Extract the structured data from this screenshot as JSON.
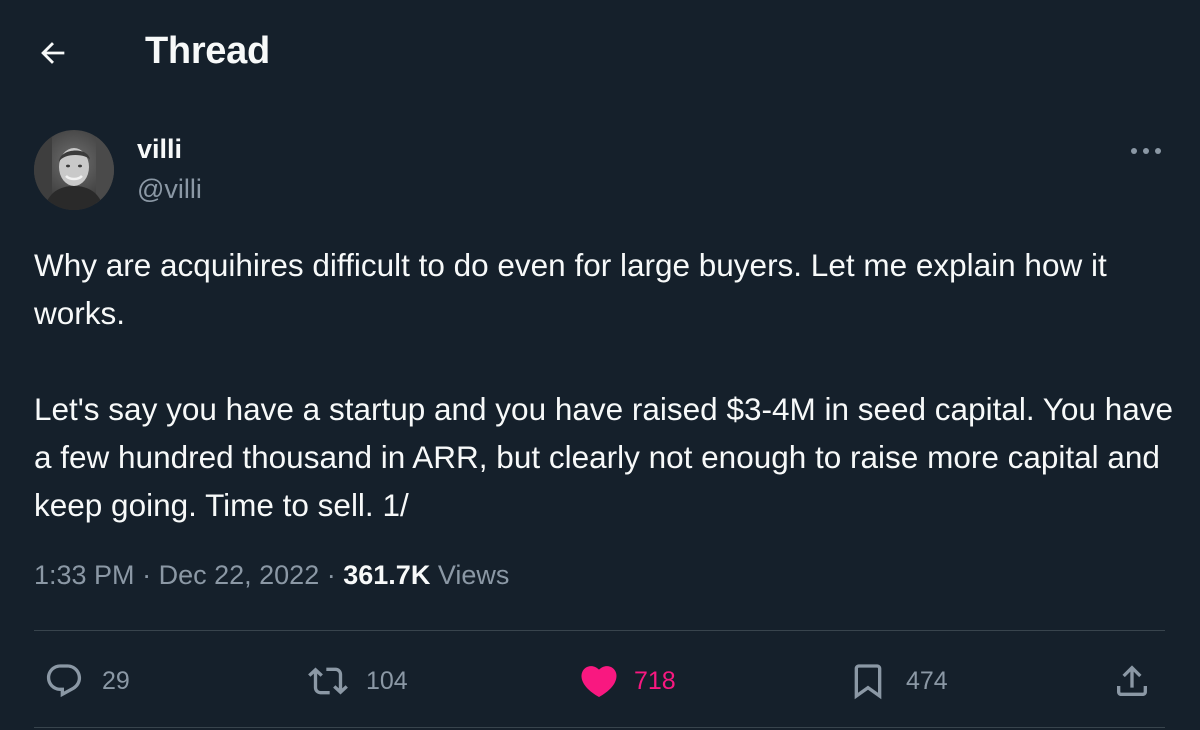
{
  "header": {
    "title": "Thread",
    "back_icon": "arrow-left-icon"
  },
  "author": {
    "name": "villi",
    "handle": "@villi",
    "avatar_icon": "profile-photo",
    "more_icon": "more-dots-icon"
  },
  "tweet": {
    "paragraphs": [
      "Why are acquihires difficult to do even for large buyers. Let me explain how it works.",
      "Let's say you have a startup and you have raised $3-4M in seed capital. You have a few hundred thousand in ARR, but clearly not enough to raise more capital and keep going. Time to sell. 1/"
    ]
  },
  "meta": {
    "time": "1:33 PM",
    "separator": "·",
    "date": "Dec 22, 2022",
    "views_count": "361.7K",
    "views_label": "Views"
  },
  "actions": {
    "reply": {
      "icon": "reply-icon",
      "count": "29"
    },
    "retweet": {
      "icon": "retweet-icon",
      "count": "104"
    },
    "like": {
      "icon": "heart-filled-icon",
      "count": "718",
      "liked": true
    },
    "bookmark": {
      "icon": "bookmark-icon",
      "count": "474"
    },
    "share": {
      "icon": "share-icon"
    }
  },
  "colors": {
    "background": "#15202b",
    "text_primary": "#f7f9f9",
    "text_secondary": "#8b98a5",
    "divider": "#38444d",
    "like_pink": "#f91880"
  }
}
